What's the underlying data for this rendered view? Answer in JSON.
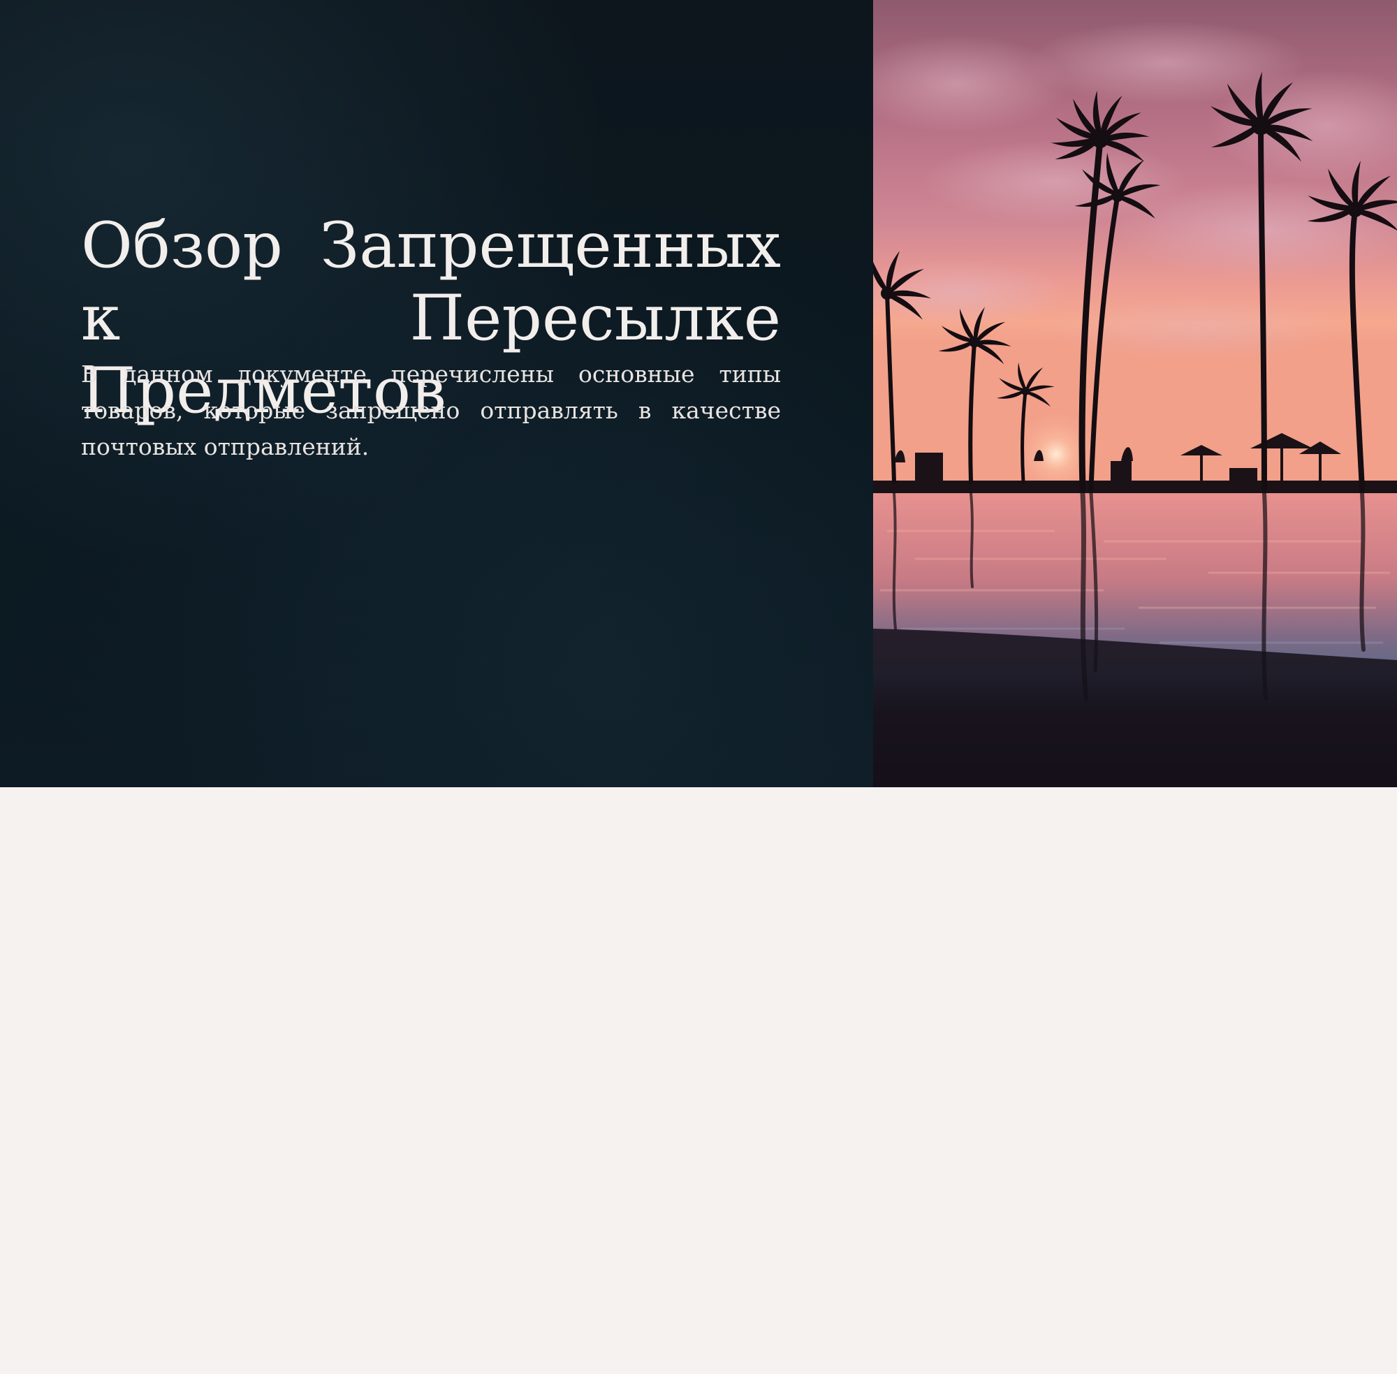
{
  "hero": {
    "title": "Обзор Запрещенных к Пересылке Предметов",
    "subtitle": "В данном документе перечислены основные типы товаров, которые запрещено отправлять в качестве почтовых отправлений."
  },
  "photo": {
    "subject": "tropical-sunset-palms-pool"
  },
  "colors": {
    "dark_panel": "#0b1820",
    "page_background": "#f6f2f0",
    "text_light": "#f2eeec",
    "sky_pink": "#c27a8e"
  }
}
